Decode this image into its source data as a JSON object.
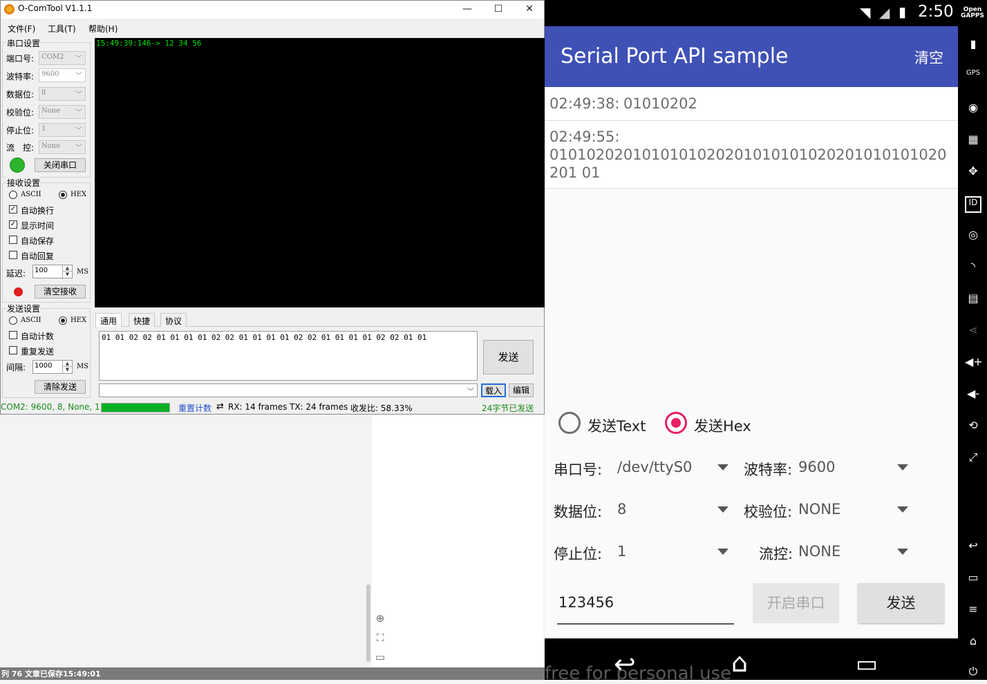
{
  "editor": {
    "status_text": "列 76   文章已保存15:49:01"
  },
  "comtool": {
    "title": "O-ComTool V1.1.1",
    "window_controls": {
      "minimize": "—",
      "maximize": "☐",
      "close": "✕"
    },
    "menu": [
      "文件(F)",
      "工具(T)",
      "帮助(H)"
    ],
    "port_settings": {
      "group_label": "串口设置",
      "port_label": "端口号:",
      "port_value": "COM2",
      "baud_label": "波特率:",
      "baud_value": "9600",
      "data_label": "数据位:",
      "data_value": "8",
      "parity_label": "校验位:",
      "parity_value": "None",
      "stop_label": "停止位:",
      "stop_value": "1",
      "flow_label": "流　控:",
      "flow_value": "None",
      "close_button": "关闭串口",
      "status_color": "#2db52d"
    },
    "receive_settings": {
      "group_label": "接收设置",
      "ascii": "ASCII",
      "hex": "HEX",
      "auto_wrap": "自动换行",
      "show_time": "显示时间",
      "auto_save": "自动保存",
      "auto_reply": "自动回复",
      "delay_label": "延迟:",
      "delay_value": "100",
      "delay_unit": "MS",
      "clear_button": "清空接收"
    },
    "send_settings": {
      "group_label": "发送设置",
      "ascii": "ASCII",
      "hex": "HEX",
      "auto_count": "自动计数",
      "repeat_send": "重复发送",
      "interval_label": "间隔:",
      "interval_value": "1000",
      "interval_unit": "MS",
      "clear_button": "清除发送"
    },
    "terminal_text": "15:49:39:146-> 12 34 56",
    "tabs": [
      "通用",
      "快捷",
      "协议"
    ],
    "send_text": "01 01 02 02 01 01 01 01 02 02 01 01 01 01 02 02 01 01 01 01 02 02 01 01",
    "send_button": "发送",
    "load_button": "载入",
    "edit_button": "编辑",
    "status": {
      "port_info": "COM2: 9600, 8, None, 1",
      "progress": 1.0,
      "reset_count": "重置计数",
      "rx": "RX: 14 frames",
      "tx": "TX: 24 frames",
      "ratio": "收发比:  58.33%",
      "sent": "24字节已发送"
    }
  },
  "android": {
    "time": "2:50",
    "app_title": "Serial Port API sample",
    "clear_action": "清空",
    "messages": [
      {
        "time": "02:49:38:",
        "text": "01010202"
      },
      {
        "time": "02:49:55:",
        "text": "0101020201010101020201010101020201010101020201 01"
      }
    ],
    "send_text_radio": "发送Text",
    "send_hex_radio": "发送Hex",
    "port_label": "串口号:",
    "port_value": "/dev/ttyS0",
    "baud_label": "波特率:",
    "baud_value": "9600",
    "data_label": "数据位:",
    "data_value": "8",
    "parity_label": "校验位:",
    "parity_value": "NONE",
    "stop_label": "停止位:",
    "stop_value": "1",
    "flow_label": "流控:",
    "flow_value": "NONE",
    "input_value": "123456",
    "open_button": "开启串口",
    "send_button": "发送",
    "watermark": "free for personal use",
    "accent": "#e91e63",
    "primary": "#3f51b5"
  }
}
